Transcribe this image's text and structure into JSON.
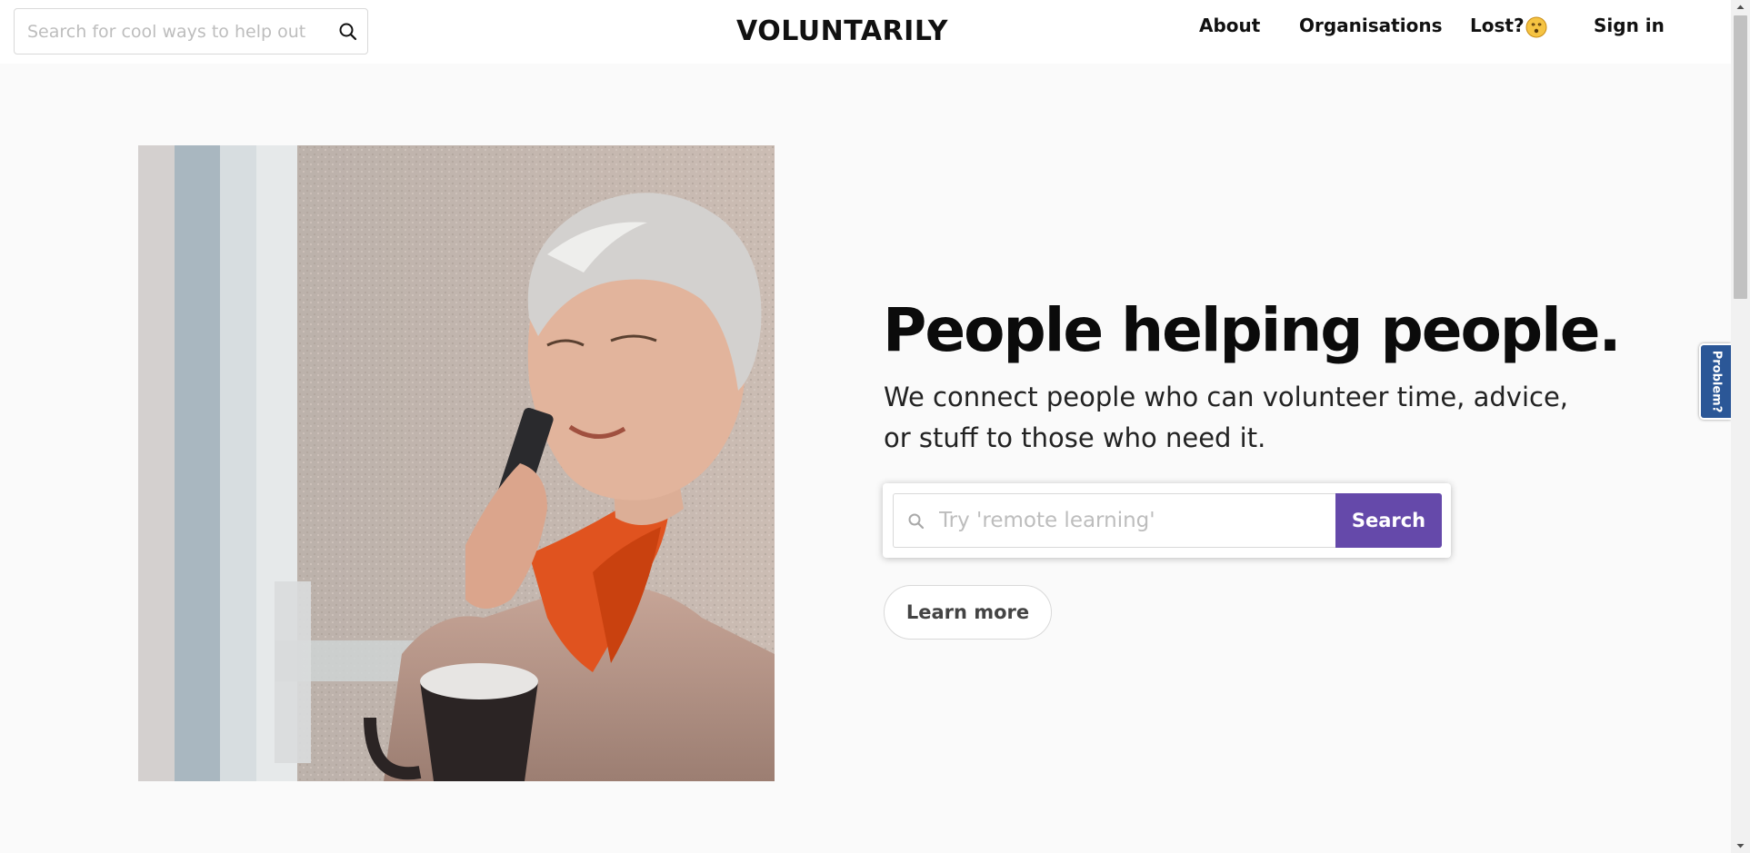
{
  "header": {
    "search": {
      "placeholder": "Search for cool ways to help out"
    },
    "logo": "VOLUNTARILY",
    "nav": {
      "about": "About",
      "organisations": "Organisations",
      "lost": "Lost?",
      "signin": "Sign in"
    }
  },
  "hero": {
    "headline": "People helping people.",
    "subhead": "We connect people who can volunteer time, advice, or stuff to those who need it.",
    "search": {
      "placeholder": "Try 'remote learning'",
      "button": "Search"
    },
    "learn_more": "Learn more"
  },
  "feedback": {
    "label": "Problem?"
  },
  "colors": {
    "accent": "#6549aa",
    "feedback_tab": "#2b5797",
    "background": "#fafafa"
  },
  "icons": [
    "search-icon",
    "dizzy-face-emoji-icon",
    "scroll-up-arrow-icon",
    "scroll-down-arrow-icon"
  ]
}
